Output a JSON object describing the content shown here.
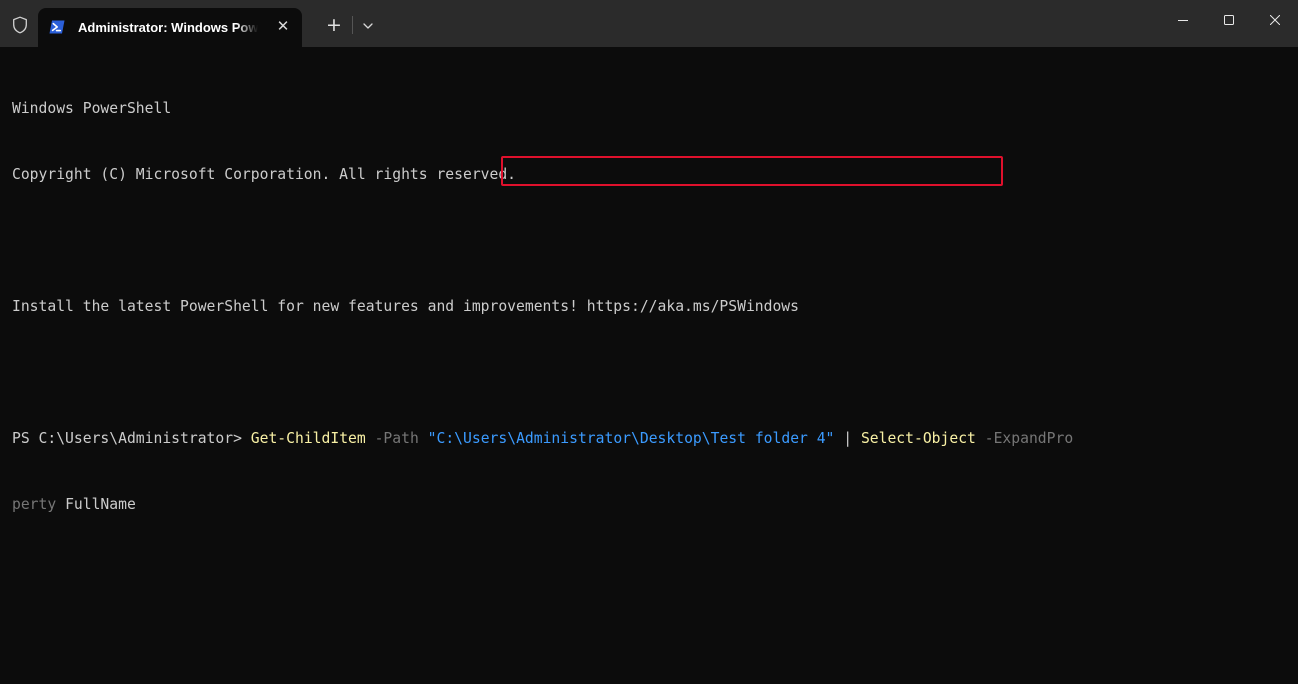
{
  "titlebar": {
    "tab_title": "Administrator: Windows PowerShell",
    "close_tab_glyph": "✕",
    "new_tab_glyph": "+",
    "icons": [
      "shield-icon",
      "powershell-icon",
      "close-icon",
      "plus-icon",
      "chevron-down-icon",
      "minimize-icon",
      "maximize-icon",
      "close-window-icon"
    ]
  },
  "terminal": {
    "banner_line1": "Windows PowerShell",
    "banner_line2": "Copyright (C) Microsoft Corporation. All rights reserved.",
    "install_message": "Install the latest PowerShell for new features and improvements! https://aka.ms/PSWindows",
    "command": {
      "prompt": "PS C:\\Users\\Administrator> ",
      "cmdlet1": "Get-ChildItem",
      "param1": "-Path",
      "path_argument": "\"C:\\Users\\Administrator\\Desktop\\Test folder 4\"",
      "pipe": "|",
      "cmdlet2": "Select-Object",
      "param2_part1": "-ExpandPro",
      "param2_part2": "perty",
      "value2": "FullName"
    }
  },
  "colors": {
    "background": "#0c0c0c",
    "titlebar": "#2b2b2b",
    "text": "#cccccc",
    "cmdlet": "#f9f1a5",
    "parameter": "#767676",
    "string": "#3b9bff",
    "highlight_border": "#e0102c",
    "powershell_icon": "#2b5fd9"
  }
}
